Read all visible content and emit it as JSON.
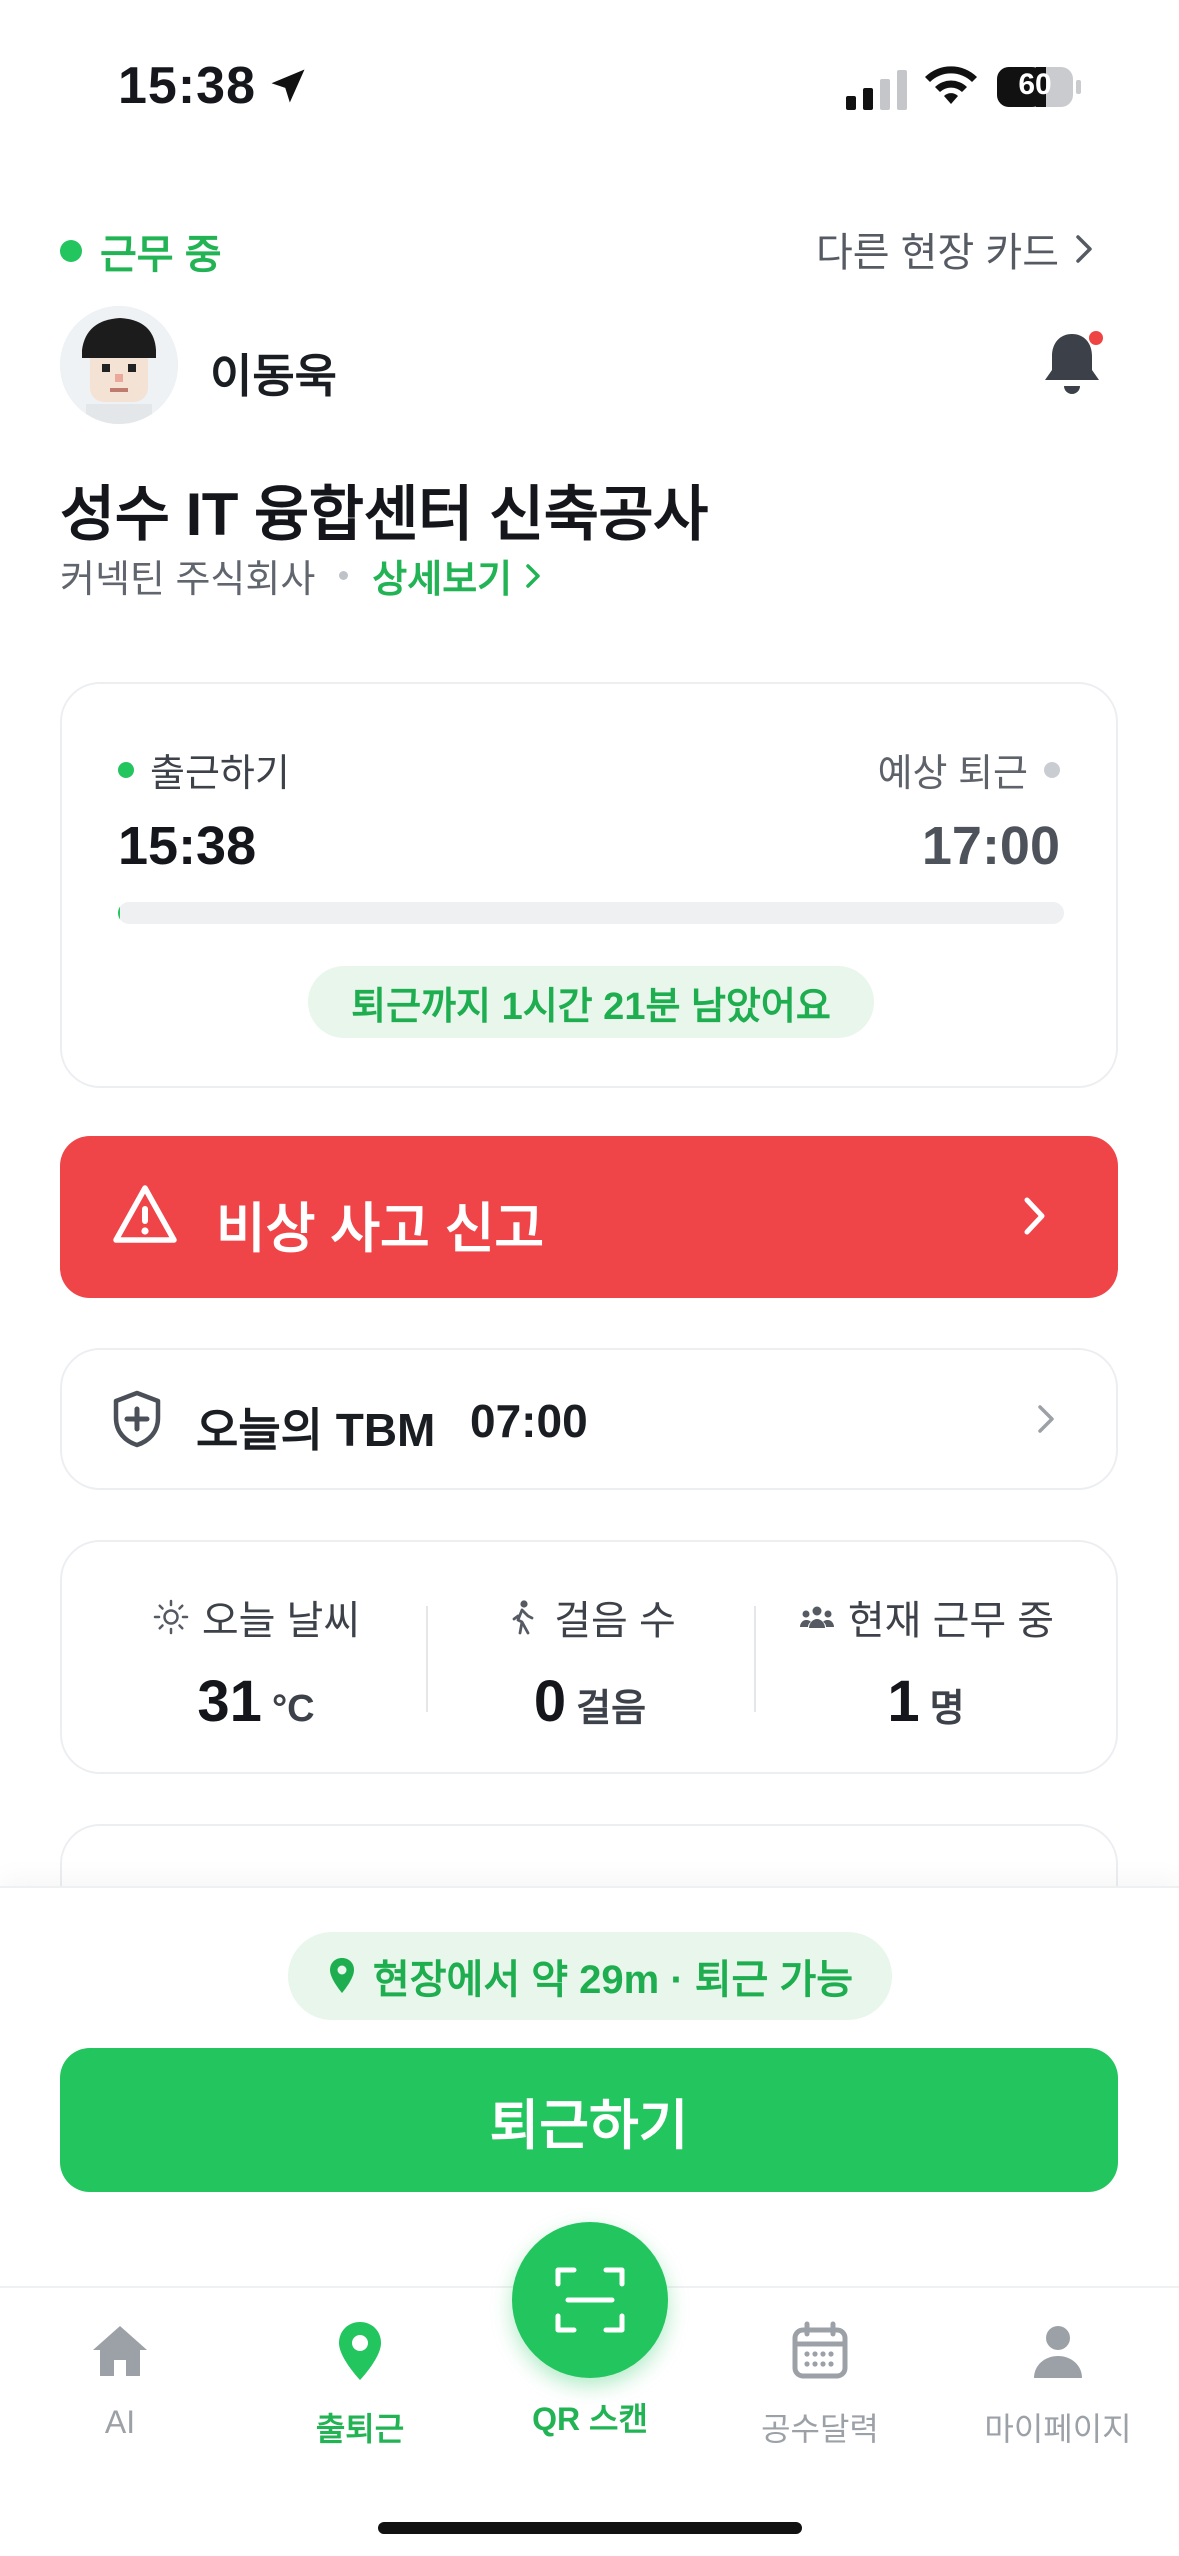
{
  "status_bar": {
    "time": "15:38",
    "battery": "60"
  },
  "header": {
    "work_status": "근무 중",
    "other_site_link": "다른 현장 카드",
    "user_name": "이동욱"
  },
  "site": {
    "title": "성수 IT 융합센터 신축공사",
    "company": "커넥틴 주식회사",
    "detail_link": "상세보기"
  },
  "commute": {
    "checkin_label": "출근하기",
    "checkin_time": "15:38",
    "expected_label": "예상 퇴근",
    "expected_time": "17:00",
    "progress_fraction": 0.002,
    "remaining_text": "퇴근까지 1시간 21분 남았어요"
  },
  "emergency": {
    "label": "비상 사고 신고"
  },
  "tbm": {
    "label": "오늘의 TBM",
    "time": "07:00"
  },
  "stats": [
    {
      "label": "오늘 날씨",
      "value": "31",
      "unit": "°C",
      "icon": "sun-icon"
    },
    {
      "label": "걸음 수",
      "value": "0",
      "unit": "걸음",
      "icon": "walk-icon"
    },
    {
      "label": "현재 근무 중",
      "value": "1",
      "unit": "명",
      "icon": "people-icon"
    }
  ],
  "geofence": {
    "text": "현장에서 약 29m · 퇴근 가능"
  },
  "checkout_button": "퇴근하기",
  "tabs": [
    {
      "label": "AI",
      "icon": "home-icon"
    },
    {
      "label": "출퇴근",
      "icon": "location-pin-icon"
    },
    {
      "label": "QR 스캔",
      "icon": "qr-scan-icon"
    },
    {
      "label": "공수달력",
      "icon": "calendar-icon"
    },
    {
      "label": "마이페이지",
      "icon": "person-icon"
    }
  ],
  "colors": {
    "accent": "#22c55e",
    "danger": "#ef4448",
    "notification_dot": "#ef4444"
  }
}
